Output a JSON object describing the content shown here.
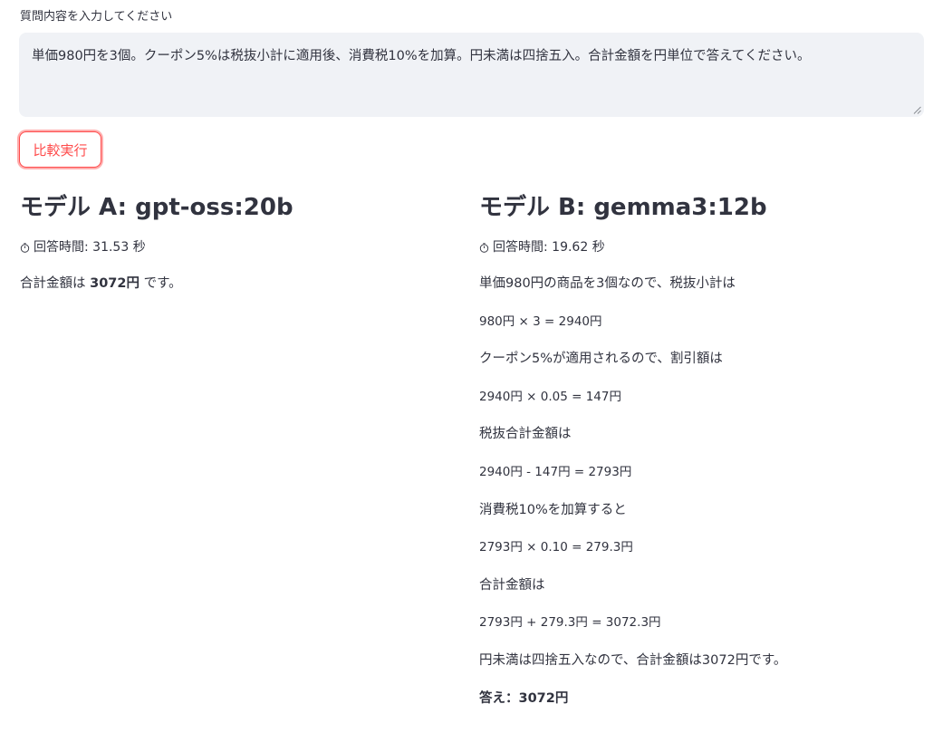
{
  "question": {
    "label": "質問内容を入力してください",
    "value": "単価980円を3個。クーポン5%は税抜小計に適用後、消費税10%を加算。円未満は四捨五入。合計金額を円単位で答えてください。"
  },
  "compare_button": {
    "label": "比較実行"
  },
  "model_a": {
    "title": "モデル A: gpt-oss:20b",
    "time_text": "回答時間: 31.53 秒",
    "answer_prefix": "合計金額は ",
    "answer_bold": "3072円",
    "answer_suffix": " です。"
  },
  "model_b": {
    "title": "モデル B: gemma3:12b",
    "time_text": "回答時間: 19.62 秒",
    "lines": [
      "単価980円の商品を3個なので、税抜小計は",
      "980円 × 3 = 2940円",
      "クーポン5%が適用されるので、割引額は",
      "2940円 × 0.05 = 147円",
      "税抜合計金額は",
      "2940円 - 147円 = 2793円",
      "消費税10%を加算すると",
      "2793円 × 0.10 = 279.3円",
      "合計金額は",
      "2793円 + 279.3円 = 3072.3円",
      "円未満は四捨五入なので、合計金額は3072円です。"
    ],
    "final_answer": "答え：3072円"
  },
  "icons": {
    "timer": "stopwatch-icon",
    "resize": "resize-handle-icon"
  },
  "colors": {
    "accent": "#ff4b4b",
    "text": "#31333f",
    "input_bg": "#f0f2f6"
  }
}
